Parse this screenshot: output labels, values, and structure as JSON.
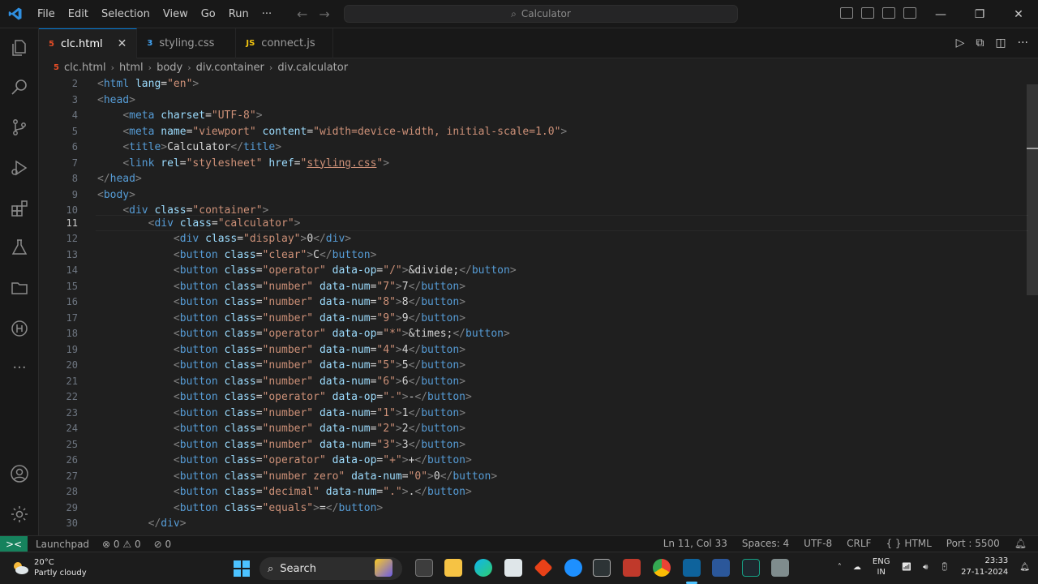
{
  "menu": [
    "File",
    "Edit",
    "Selection",
    "View",
    "Go",
    "Run",
    "···"
  ],
  "command_center": "Calculator",
  "tabs": [
    {
      "label": "clc.html",
      "badge": "5",
      "active": true
    },
    {
      "label": "styling.css",
      "badge": "3",
      "active": false
    },
    {
      "label": "connect.js",
      "badge": "JS",
      "active": false
    }
  ],
  "breadcrumb": [
    "clc.html",
    "html",
    "body",
    "div.container",
    "div.calculator"
  ],
  "editor": {
    "line_numbers": [
      "2",
      "3",
      "4",
      "5",
      "6",
      "7",
      "8",
      "9",
      "10",
      "11",
      "12",
      "13",
      "14",
      "15",
      "16",
      "17",
      "18",
      "19",
      "20",
      "21",
      "22",
      "23",
      "24",
      "25",
      "26",
      "27",
      "28",
      "29",
      "30"
    ],
    "current_line": "11"
  },
  "status": {
    "remote": "><",
    "launchpad": "Launchpad",
    "problems": "⊗ 0 ⚠ 0",
    "ports": "⊘ 0",
    "position": "Ln 11, Col 33",
    "spaces": "Spaces: 4",
    "encoding": "UTF-8",
    "eol": "CRLF",
    "language": "{ } HTML",
    "port": "Port : 5500"
  },
  "taskbar": {
    "temperature": "20°C",
    "weather": "Partly cloudy",
    "search": "Search",
    "lang_top": "ENG",
    "lang_bottom": "IN",
    "time": "23:33",
    "date": "27-11-2024"
  },
  "colors": {
    "accent": "#0078d4",
    "html_badge": "#e44d26",
    "css_badge": "#42a5f5",
    "js_badge": "#f1c40f"
  }
}
